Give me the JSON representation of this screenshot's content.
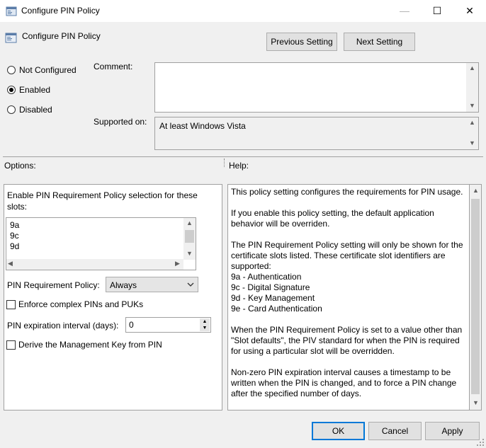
{
  "window": {
    "title": "Configure PIN Policy",
    "minimize": "—",
    "maximize": "☐",
    "close": "✕"
  },
  "header": {
    "policy_name": "Configure PIN Policy",
    "previous_setting": "Previous Setting",
    "next_setting": "Next Setting"
  },
  "state": {
    "not_configured": "Not Configured",
    "enabled": "Enabled",
    "disabled": "Disabled",
    "selected": "Enabled"
  },
  "comment": {
    "label": "Comment:",
    "value": ""
  },
  "supported": {
    "label": "Supported on:",
    "value": "At least Windows Vista"
  },
  "options": {
    "header": "Options:",
    "slots_label_line1": "Enable PIN Requirement Policy selection for these",
    "slots_label_line2": "slots:",
    "slots": [
      "9a",
      "9c",
      "9d"
    ],
    "pin_requirement_label": "PIN Requirement Policy:",
    "pin_requirement_value": "Always",
    "enforce_complex_label": "Enforce complex PINs and PUKs",
    "enforce_complex_checked": false,
    "expiration_label": "PIN expiration interval (days):",
    "expiration_value": "0",
    "derive_key_label": "Derive the Management Key from PIN",
    "derive_key_checked": false
  },
  "help": {
    "header": "Help:",
    "lines": [
      "This policy setting configures the requirements for PIN usage.",
      "",
      "If you enable this policy setting, the default application",
      "behavior will be overriden.",
      "",
      "The PIN Requirement Policy setting will only be shown for the",
      "certificate slots listed. These certificate slot identifiers are",
      "supported:",
      "9a - Authentication",
      "9c - Digital Signature",
      "9d - Key Management",
      "9e - Card Authentication",
      "",
      "When the PIN Requirement Policy is set to a value other than",
      "\"Slot defaults\", the PIV standard for when the PIN is required",
      "for using a particular slot will be overridden.",
      "",
      "Non-zero PIN expiration interval causes a timestamp to be",
      "written when the PIN is changed, and to force a PIN change",
      "after the specified number of days."
    ]
  },
  "footer": {
    "ok": "OK",
    "cancel": "Cancel",
    "apply": "Apply"
  }
}
